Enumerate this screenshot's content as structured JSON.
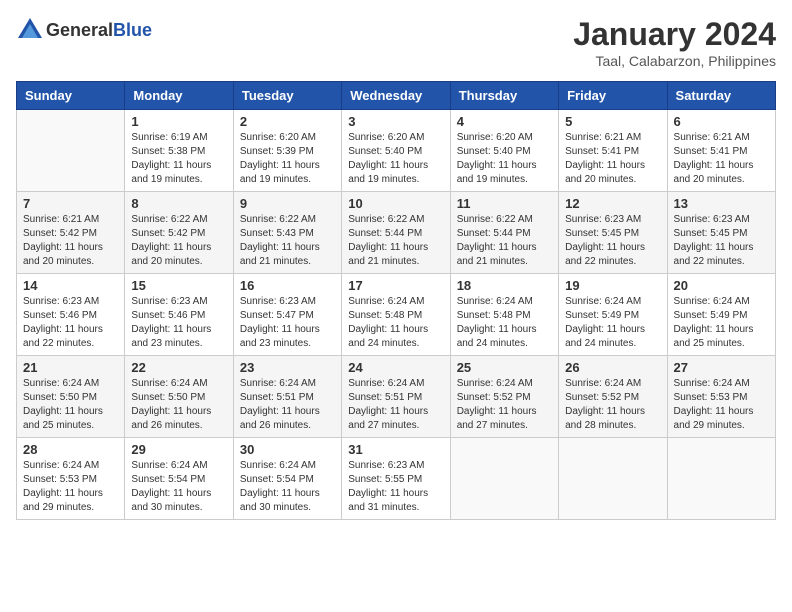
{
  "header": {
    "logo_general": "General",
    "logo_blue": "Blue",
    "month": "January 2024",
    "location": "Taal, Calabarzon, Philippines"
  },
  "days_of_week": [
    "Sunday",
    "Monday",
    "Tuesday",
    "Wednesday",
    "Thursday",
    "Friday",
    "Saturday"
  ],
  "weeks": [
    [
      {
        "day": "",
        "info": ""
      },
      {
        "day": "1",
        "info": "Sunrise: 6:19 AM\nSunset: 5:38 PM\nDaylight: 11 hours\nand 19 minutes."
      },
      {
        "day": "2",
        "info": "Sunrise: 6:20 AM\nSunset: 5:39 PM\nDaylight: 11 hours\nand 19 minutes."
      },
      {
        "day": "3",
        "info": "Sunrise: 6:20 AM\nSunset: 5:40 PM\nDaylight: 11 hours\nand 19 minutes."
      },
      {
        "day": "4",
        "info": "Sunrise: 6:20 AM\nSunset: 5:40 PM\nDaylight: 11 hours\nand 19 minutes."
      },
      {
        "day": "5",
        "info": "Sunrise: 6:21 AM\nSunset: 5:41 PM\nDaylight: 11 hours\nand 20 minutes."
      },
      {
        "day": "6",
        "info": "Sunrise: 6:21 AM\nSunset: 5:41 PM\nDaylight: 11 hours\nand 20 minutes."
      }
    ],
    [
      {
        "day": "7",
        "info": "Sunrise: 6:21 AM\nSunset: 5:42 PM\nDaylight: 11 hours\nand 20 minutes."
      },
      {
        "day": "8",
        "info": "Sunrise: 6:22 AM\nSunset: 5:42 PM\nDaylight: 11 hours\nand 20 minutes."
      },
      {
        "day": "9",
        "info": "Sunrise: 6:22 AM\nSunset: 5:43 PM\nDaylight: 11 hours\nand 21 minutes."
      },
      {
        "day": "10",
        "info": "Sunrise: 6:22 AM\nSunset: 5:44 PM\nDaylight: 11 hours\nand 21 minutes."
      },
      {
        "day": "11",
        "info": "Sunrise: 6:22 AM\nSunset: 5:44 PM\nDaylight: 11 hours\nand 21 minutes."
      },
      {
        "day": "12",
        "info": "Sunrise: 6:23 AM\nSunset: 5:45 PM\nDaylight: 11 hours\nand 22 minutes."
      },
      {
        "day": "13",
        "info": "Sunrise: 6:23 AM\nSunset: 5:45 PM\nDaylight: 11 hours\nand 22 minutes."
      }
    ],
    [
      {
        "day": "14",
        "info": "Sunrise: 6:23 AM\nSunset: 5:46 PM\nDaylight: 11 hours\nand 22 minutes."
      },
      {
        "day": "15",
        "info": "Sunrise: 6:23 AM\nSunset: 5:46 PM\nDaylight: 11 hours\nand 23 minutes."
      },
      {
        "day": "16",
        "info": "Sunrise: 6:23 AM\nSunset: 5:47 PM\nDaylight: 11 hours\nand 23 minutes."
      },
      {
        "day": "17",
        "info": "Sunrise: 6:24 AM\nSunset: 5:48 PM\nDaylight: 11 hours\nand 24 minutes."
      },
      {
        "day": "18",
        "info": "Sunrise: 6:24 AM\nSunset: 5:48 PM\nDaylight: 11 hours\nand 24 minutes."
      },
      {
        "day": "19",
        "info": "Sunrise: 6:24 AM\nSunset: 5:49 PM\nDaylight: 11 hours\nand 24 minutes."
      },
      {
        "day": "20",
        "info": "Sunrise: 6:24 AM\nSunset: 5:49 PM\nDaylight: 11 hours\nand 25 minutes."
      }
    ],
    [
      {
        "day": "21",
        "info": "Sunrise: 6:24 AM\nSunset: 5:50 PM\nDaylight: 11 hours\nand 25 minutes."
      },
      {
        "day": "22",
        "info": "Sunrise: 6:24 AM\nSunset: 5:50 PM\nDaylight: 11 hours\nand 26 minutes."
      },
      {
        "day": "23",
        "info": "Sunrise: 6:24 AM\nSunset: 5:51 PM\nDaylight: 11 hours\nand 26 minutes."
      },
      {
        "day": "24",
        "info": "Sunrise: 6:24 AM\nSunset: 5:51 PM\nDaylight: 11 hours\nand 27 minutes."
      },
      {
        "day": "25",
        "info": "Sunrise: 6:24 AM\nSunset: 5:52 PM\nDaylight: 11 hours\nand 27 minutes."
      },
      {
        "day": "26",
        "info": "Sunrise: 6:24 AM\nSunset: 5:52 PM\nDaylight: 11 hours\nand 28 minutes."
      },
      {
        "day": "27",
        "info": "Sunrise: 6:24 AM\nSunset: 5:53 PM\nDaylight: 11 hours\nand 29 minutes."
      }
    ],
    [
      {
        "day": "28",
        "info": "Sunrise: 6:24 AM\nSunset: 5:53 PM\nDaylight: 11 hours\nand 29 minutes."
      },
      {
        "day": "29",
        "info": "Sunrise: 6:24 AM\nSunset: 5:54 PM\nDaylight: 11 hours\nand 30 minutes."
      },
      {
        "day": "30",
        "info": "Sunrise: 6:24 AM\nSunset: 5:54 PM\nDaylight: 11 hours\nand 30 minutes."
      },
      {
        "day": "31",
        "info": "Sunrise: 6:23 AM\nSunset: 5:55 PM\nDaylight: 11 hours\nand 31 minutes."
      },
      {
        "day": "",
        "info": ""
      },
      {
        "day": "",
        "info": ""
      },
      {
        "day": "",
        "info": ""
      }
    ]
  ]
}
